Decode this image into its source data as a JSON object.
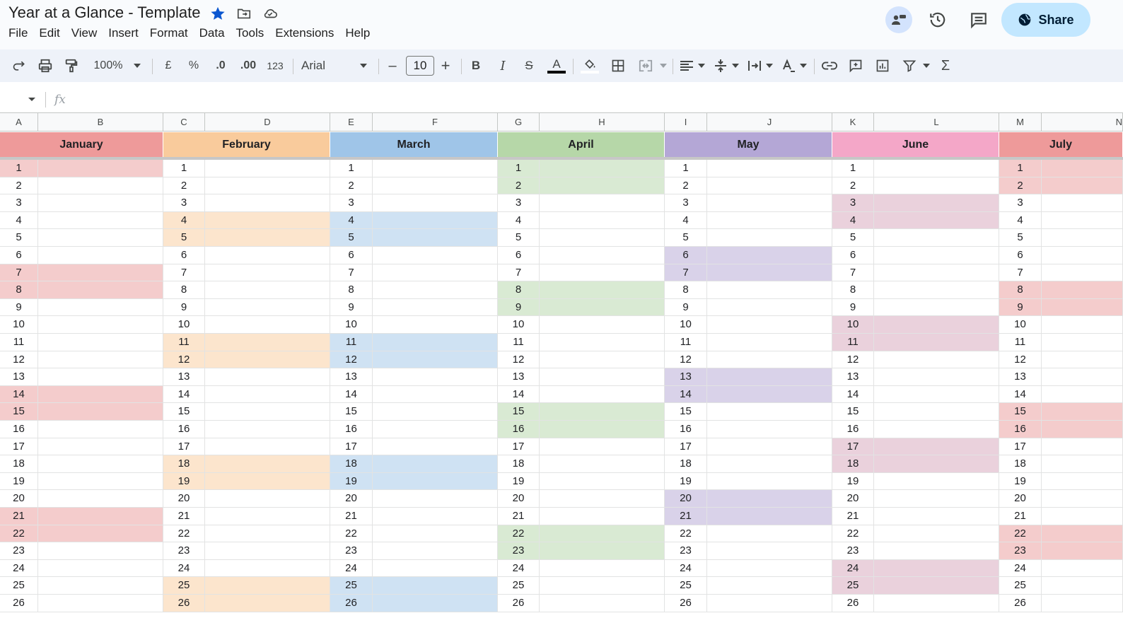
{
  "document": {
    "title": "Year at a Glance - Template"
  },
  "menu": [
    "File",
    "Edit",
    "View",
    "Insert",
    "Format",
    "Data",
    "Tools",
    "Extensions",
    "Help"
  ],
  "header_actions": {
    "share_label": "Share"
  },
  "toolbar": {
    "zoom": "100%",
    "currency": "£",
    "percent": "%",
    "decrease_decimal": ".0",
    "increase_decimal": ".00",
    "number_format": "123",
    "font": "Arial",
    "font_size": "10",
    "minus": "–",
    "plus": "+",
    "bold": "B",
    "italic": "I",
    "strike": "S",
    "text_color": "A",
    "sum": "Σ"
  },
  "formula_bar": {
    "fx": "fx"
  },
  "columns": [
    "A",
    "B",
    "C",
    "D",
    "E",
    "F",
    "G",
    "H",
    "I",
    "J",
    "K",
    "L",
    "M",
    "N"
  ],
  "months": [
    {
      "name": "January",
      "color": "#ee9a9a",
      "light": "#f4cccc"
    },
    {
      "name": "February",
      "color": "#f9cb9c",
      "light": "#fce5cd"
    },
    {
      "name": "March",
      "color": "#9fc5e8",
      "light": "#cfe2f3"
    },
    {
      "name": "April",
      "color": "#b6d7a8",
      "light": "#d9ead3"
    },
    {
      "name": "May",
      "color": "#b4a7d6",
      "light": "#d9d2e9"
    },
    {
      "name": "June",
      "color": "#f4a7c8",
      "light": "#ead1dc"
    },
    {
      "name": "July",
      "color": "#ee9a9a",
      "light": "#f4cccc"
    }
  ],
  "days": [
    "1",
    "2",
    "3",
    "4",
    "5",
    "6",
    "7",
    "8",
    "9",
    "10",
    "11",
    "12",
    "13",
    "14",
    "15",
    "16",
    "17",
    "18",
    "19",
    "20",
    "21",
    "22",
    "23",
    "24",
    "25",
    "26"
  ],
  "weekend_days": [
    [
      1,
      7,
      8,
      14,
      15,
      21,
      22
    ],
    [
      4,
      5,
      11,
      12,
      18,
      19,
      25,
      26
    ],
    [
      4,
      5,
      11,
      12,
      18,
      19,
      25,
      26
    ],
    [
      1,
      2,
      8,
      9,
      15,
      16,
      22,
      23
    ],
    [
      6,
      7,
      13,
      14,
      20,
      21
    ],
    [
      3,
      4,
      10,
      11,
      17,
      18,
      24,
      25
    ],
    [
      1,
      2,
      8,
      9,
      15,
      16,
      22,
      23
    ]
  ]
}
